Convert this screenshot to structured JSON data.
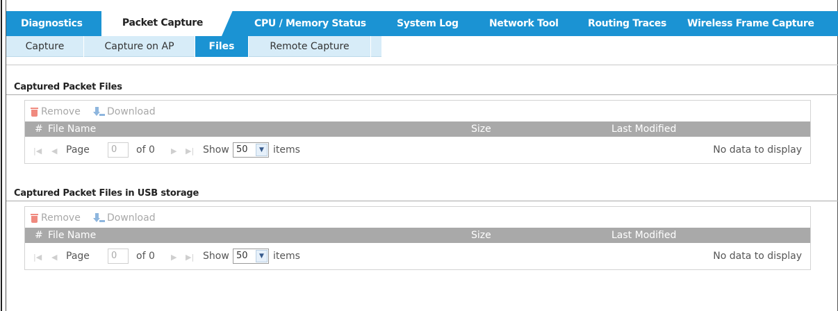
{
  "main_tabs": [
    {
      "label": "Diagnostics",
      "active": false
    },
    {
      "label": "Packet Capture",
      "active": true
    },
    {
      "label": "CPU / Memory Status",
      "active": false
    },
    {
      "label": "System Log",
      "active": false
    },
    {
      "label": "Network Tool",
      "active": false
    },
    {
      "label": "Routing Traces",
      "active": false
    },
    {
      "label": "Wireless Frame Capture",
      "active": false
    }
  ],
  "sub_tabs": [
    {
      "label": "Capture",
      "active": false
    },
    {
      "label": "Capture on AP",
      "active": false
    },
    {
      "label": "Files",
      "active": true
    },
    {
      "label": "Remote Capture",
      "active": false
    }
  ],
  "sections": [
    {
      "title": "Captured Packet Files",
      "toolbar": {
        "remove_label": "Remove",
        "download_label": "Download"
      },
      "columns": {
        "num": "#",
        "file_name": "File Name",
        "size": "Size",
        "last_modified": "Last Modified"
      },
      "pager": {
        "page_label": "Page",
        "page_value": "0",
        "of_label": "of 0",
        "show_label": "Show",
        "show_value": "50",
        "items_label": "items",
        "empty_text": "No data to display"
      }
    },
    {
      "title": "Captured Packet Files in USB storage",
      "toolbar": {
        "remove_label": "Remove",
        "download_label": "Download"
      },
      "columns": {
        "num": "#",
        "file_name": "File Name",
        "size": "Size",
        "last_modified": "Last Modified"
      },
      "pager": {
        "page_label": "Page",
        "page_value": "0",
        "of_label": "of 0",
        "show_label": "Show",
        "show_value": "50",
        "items_label": "items",
        "empty_text": "No data to display"
      }
    }
  ],
  "colors": {
    "accent": "#1b93d3",
    "subtab_bg": "#d7ecf8",
    "header_gray": "#a9a9a9",
    "remove_icon": "#f08a7f",
    "download_icon": "#8eb6de"
  },
  "icons": [
    "trash-icon",
    "download-icon",
    "first-page-icon",
    "prev-page-icon",
    "next-page-icon",
    "last-page-icon",
    "dropdown-arrow-icon"
  ]
}
